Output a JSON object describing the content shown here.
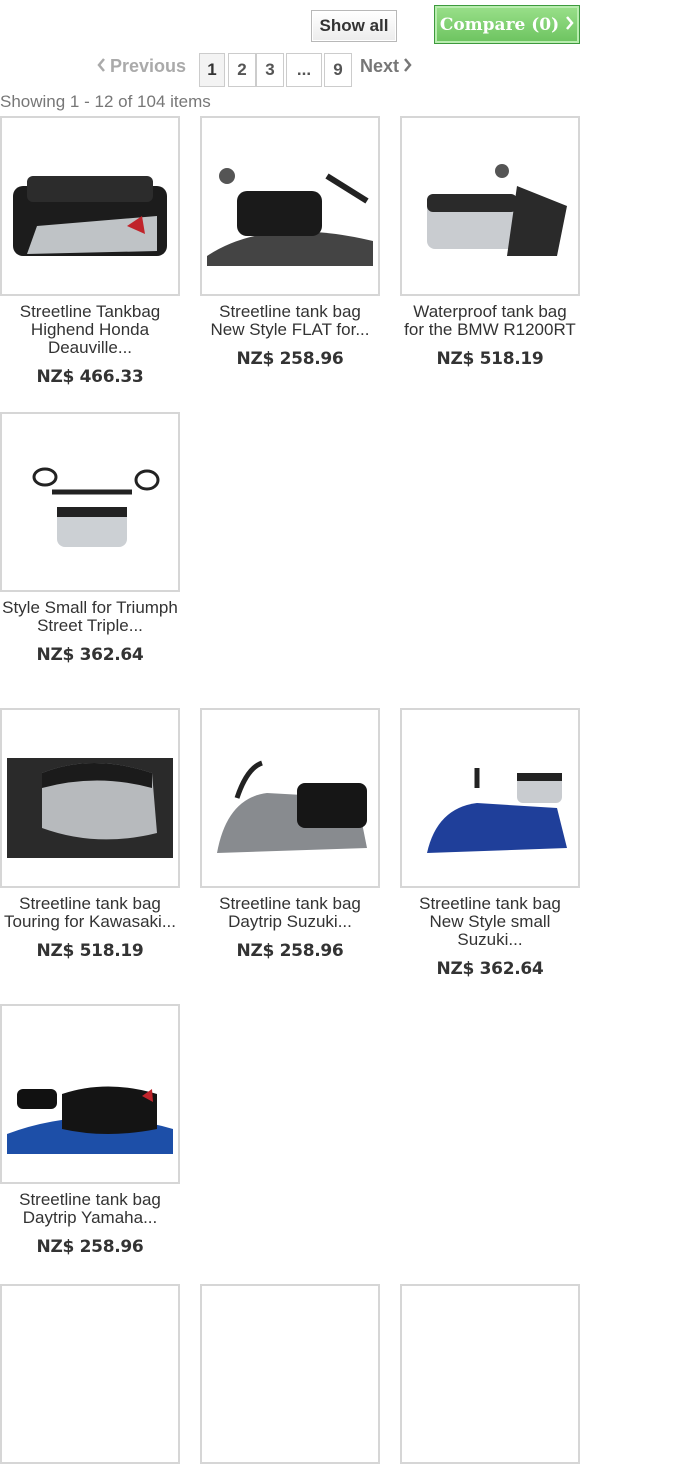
{
  "toolbar": {
    "show_all": "Show all",
    "compare": "Compare (0)"
  },
  "pagination": {
    "previous": "Previous",
    "next": "Next",
    "pages": [
      "1",
      "2",
      "3",
      "...",
      "9"
    ],
    "current": "1"
  },
  "showing": "Showing 1 - 12 of 104 items",
  "products": [
    {
      "name": "Streetline Tankbag Highend Honda Deauville...",
      "price": "NZ$ 466.33"
    },
    {
      "name": "Streetline tank bag New Style FLAT for...",
      "price": "NZ$ 258.96"
    },
    {
      "name": "Waterproof tank bag for the BMW R1200RT",
      "price": "NZ$ 518.19"
    },
    {
      "name": "Style Small for Triumph Street Triple...",
      "price": "NZ$ 362.64"
    },
    {
      "name": "Streetline tank bag Touring for Kawasaki...",
      "price": "NZ$ 518.19"
    },
    {
      "name": "Streetline tank bag Daytrip Suzuki...",
      "price": "NZ$ 258.96"
    },
    {
      "name": "Streetline tank bag New Style small Suzuki...",
      "price": "NZ$ 362.64"
    },
    {
      "name": "Streetline tank bag Daytrip Yamaha...",
      "price": "NZ$ 258.96"
    },
    {
      "name": "",
      "price": ""
    },
    {
      "name": "",
      "price": ""
    },
    {
      "name": "",
      "price": ""
    }
  ],
  "colors": {
    "compare_green": "#6cc35f",
    "border": "#d6d6d6",
    "muted_text": "#777777"
  },
  "icons": {
    "prev": "chevron-left-icon",
    "next": "chevron-right-icon",
    "compare": "chevron-right-icon"
  }
}
